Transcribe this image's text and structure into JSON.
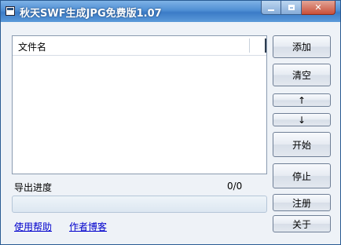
{
  "window": {
    "title": "秋天SWF生成JPG免费版1.07"
  },
  "list": {
    "column_header": "文件名",
    "rows": []
  },
  "buttons": {
    "add": "添加",
    "clear": "清空",
    "move_up": "↑",
    "move_down": "↓",
    "start": "开始",
    "stop": "停止",
    "register": "注册",
    "about": "关于"
  },
  "progress": {
    "label": "导出进度",
    "count": "0/0",
    "fraction": 0
  },
  "links": {
    "help": "使用帮助",
    "author_blog": "作者博客"
  }
}
